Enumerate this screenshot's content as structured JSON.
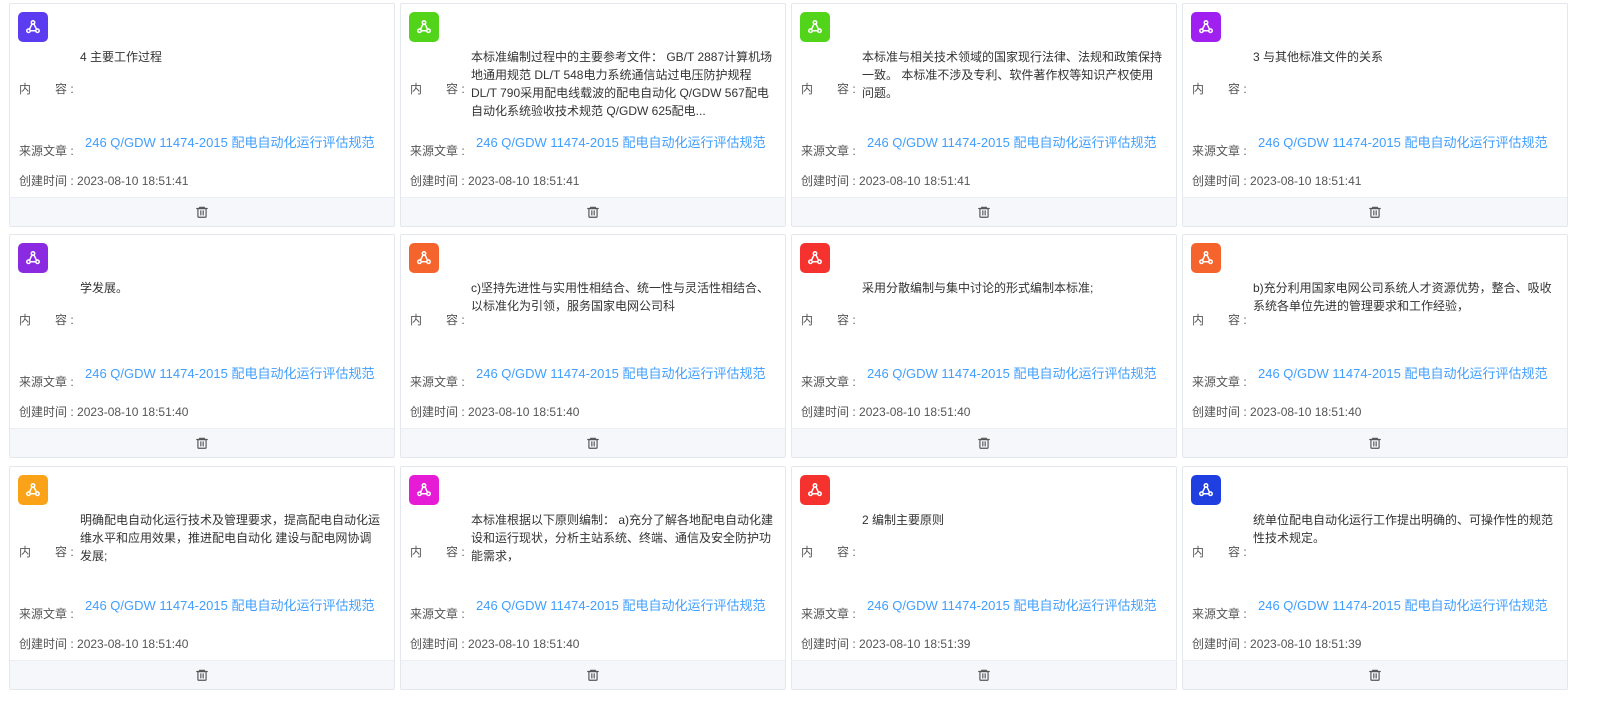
{
  "labels": {
    "content": "内　　容 :",
    "source": "来源文章 :",
    "created": "创建时间 : "
  },
  "cards": [
    {
      "icon_color": "#5b3cf0",
      "content": "4 主要工作过程",
      "source": "246 Q/GDW 11474-2015 配电自动化运行评估规范",
      "created": "2023-08-10 18:51:41"
    },
    {
      "icon_color": "#52d41a",
      "content": "本标准编制过程中的主要参考文件： GB/T 2887计算机场地通用规范 DL/T 548电力系统通信站过电压防护规程 DL/T 790采用配电线载波的配电自动化 Q/GDW 567配电自动化系统验收技术规范 Q/GDW 625配电...",
      "source": "246 Q/GDW 11474-2015 配电自动化运行评估规范",
      "created": "2023-08-10 18:51:41"
    },
    {
      "icon_color": "#52d41a",
      "content": "本标准与相关技术领域的国家现行法律、法规和政策保持一致。 本标准不涉及专利、软件著作权等知识产权使用问题。",
      "source": "246 Q/GDW 11474-2015 配电自动化运行评估规范",
      "created": "2023-08-10 18:51:41"
    },
    {
      "icon_color": "#a020f0",
      "content": "3 与其他标准文件的关系",
      "source": "246 Q/GDW 11474-2015 配电自动化运行评估规范",
      "created": "2023-08-10 18:51:41"
    },
    {
      "icon_color": "#8a2be2",
      "content": "学发展。",
      "source": "246 Q/GDW 11474-2015 配电自动化运行评估规范",
      "created": "2023-08-10 18:51:40"
    },
    {
      "icon_color": "#f5642d",
      "content": "c)坚持先进性与实用性相结合、统一性与灵活性相结合、以标准化为引领，服务国家电网公司科",
      "source": "246 Q/GDW 11474-2015 配电自动化运行评估规范",
      "created": "2023-08-10 18:51:40"
    },
    {
      "icon_color": "#f5322d",
      "content": "采用分散编制与集中讨论的形式编制本标准;",
      "source": "246 Q/GDW 11474-2015 配电自动化运行评估规范",
      "created": "2023-08-10 18:51:40"
    },
    {
      "icon_color": "#f5642d",
      "content": "b)充分利用国家电网公司系统人才资源优势，整合、吸收系统各单位先进的管理要求和工作经验，",
      "source": "246 Q/GDW 11474-2015 配电自动化运行评估规范",
      "created": "2023-08-10 18:51:40"
    },
    {
      "icon_color": "#faa319",
      "content": "明确配电自动化运行技术及管理要求，提高配电自动化运维水平和应用效果，推进配电自动化 建设与配电网协调发展;",
      "source": "246 Q/GDW 11474-2015 配电自动化运行评估规范",
      "created": "2023-08-10 18:51:40"
    },
    {
      "icon_color": "#e61bd6",
      "content": "本标准根据以下原则编制： a)充分了解各地配电自动化建设和运行现状，分析主站系统、终端、通信及安全防护功能需求，",
      "source": "246 Q/GDW 11474-2015 配电自动化运行评估规范",
      "created": "2023-08-10 18:51:40"
    },
    {
      "icon_color": "#f5322d",
      "content": "2 编制主要原则",
      "source": "246 Q/GDW 11474-2015 配电自动化运行评估规范",
      "created": "2023-08-10 18:51:39"
    },
    {
      "icon_color": "#1f3fe0",
      "content": "统单位配电自动化运行工作提出明确的、可操作性的规范性技术规定。",
      "source": "246 Q/GDW 11474-2015 配电自动化运行评估规范",
      "created": "2023-08-10 18:51:39"
    }
  ]
}
